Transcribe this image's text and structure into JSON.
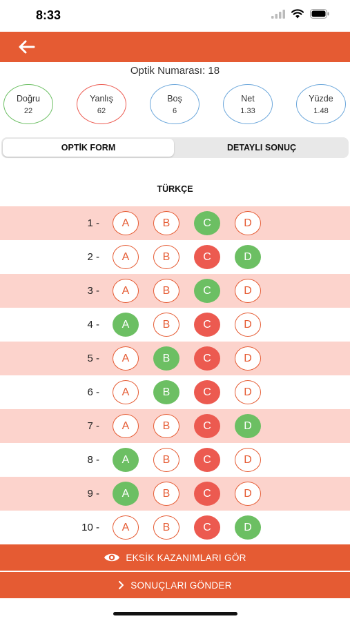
{
  "status": {
    "time": "8:33"
  },
  "header": {
    "optik_label": "Optik Numarası: 18"
  },
  "stats": [
    {
      "label": "Doğru",
      "value": "22",
      "color": "#6CBF63"
    },
    {
      "label": "Yanlış",
      "value": "62",
      "color": "#EC5A50"
    },
    {
      "label": "Boş",
      "value": "6",
      "color": "#6CA7DB"
    },
    {
      "label": "Net",
      "value": "1.33",
      "color": "#6CA7DB"
    },
    {
      "label": "Yüzde",
      "value": "1.48",
      "color": "#6CA7DB"
    }
  ],
  "tabs": {
    "optik_form": "OPTİK FORM",
    "detayli_sonuc": "DETAYLI SONUÇ"
  },
  "section": {
    "title": "TÜRKÇE"
  },
  "colors": {
    "accent": "#E55B33",
    "correct": "#6CBF63",
    "wrong": "#EC5A50",
    "row_shade": "#FCD3CC"
  },
  "questions": [
    {
      "label": "1 -",
      "options": [
        [
          "A",
          "empty"
        ],
        [
          "B",
          "empty"
        ],
        [
          "C",
          "correct"
        ],
        [
          "D",
          "empty"
        ]
      ]
    },
    {
      "label": "2 -",
      "options": [
        [
          "A",
          "empty"
        ],
        [
          "B",
          "empty"
        ],
        [
          "C",
          "wrong"
        ],
        [
          "D",
          "correct"
        ]
      ]
    },
    {
      "label": "3 -",
      "options": [
        [
          "A",
          "empty"
        ],
        [
          "B",
          "empty"
        ],
        [
          "C",
          "correct"
        ],
        [
          "D",
          "empty"
        ]
      ]
    },
    {
      "label": "4 -",
      "options": [
        [
          "A",
          "correct"
        ],
        [
          "B",
          "empty"
        ],
        [
          "C",
          "wrong"
        ],
        [
          "D",
          "empty"
        ]
      ]
    },
    {
      "label": "5 -",
      "options": [
        [
          "A",
          "empty"
        ],
        [
          "B",
          "correct"
        ],
        [
          "C",
          "wrong"
        ],
        [
          "D",
          "empty"
        ]
      ]
    },
    {
      "label": "6 -",
      "options": [
        [
          "A",
          "empty"
        ],
        [
          "B",
          "correct"
        ],
        [
          "C",
          "wrong"
        ],
        [
          "D",
          "empty"
        ]
      ]
    },
    {
      "label": "7 -",
      "options": [
        [
          "A",
          "empty"
        ],
        [
          "B",
          "empty"
        ],
        [
          "C",
          "wrong"
        ],
        [
          "D",
          "correct"
        ]
      ]
    },
    {
      "label": "8 -",
      "options": [
        [
          "A",
          "correct"
        ],
        [
          "B",
          "empty"
        ],
        [
          "C",
          "wrong"
        ],
        [
          "D",
          "empty"
        ]
      ]
    },
    {
      "label": "9 -",
      "options": [
        [
          "A",
          "correct"
        ],
        [
          "B",
          "empty"
        ],
        [
          "C",
          "wrong"
        ],
        [
          "D",
          "empty"
        ]
      ]
    },
    {
      "label": "10 -",
      "options": [
        [
          "A",
          "empty"
        ],
        [
          "B",
          "empty"
        ],
        [
          "C",
          "wrong"
        ],
        [
          "D",
          "correct"
        ]
      ]
    }
  ],
  "buttons": {
    "eksik": "EKSİK KAZANIMLARI GÖR",
    "gonder": "SONUÇLARI GÖNDER"
  }
}
